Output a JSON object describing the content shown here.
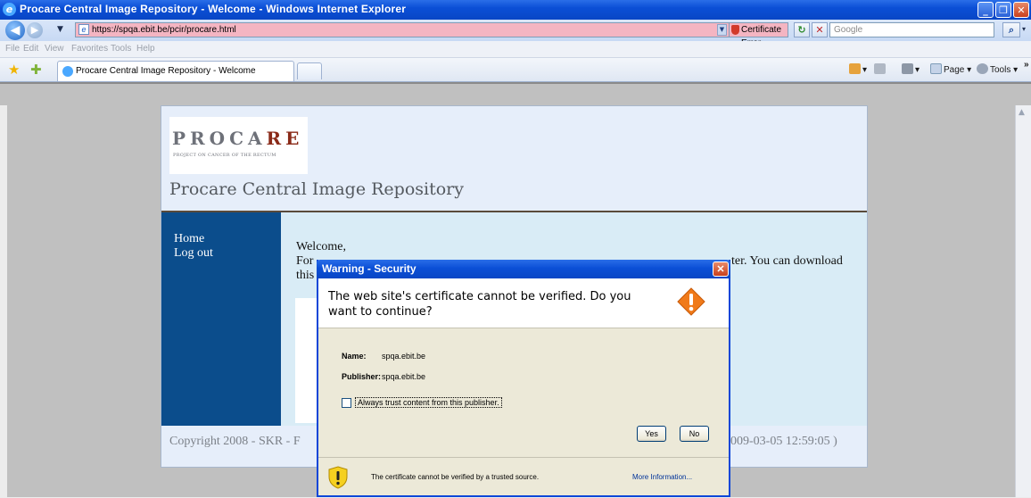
{
  "window": {
    "title": "Procare Central Image Repository - Welcome - Windows Internet Explorer"
  },
  "address": {
    "url": "https://spqa.ebit.be/pcir/procare.html",
    "cert_error": "Certificate Error",
    "search_placeholder": "Google"
  },
  "menu": [
    "File",
    "Edit",
    "View",
    "Favorites",
    "Tools",
    "Help"
  ],
  "tabs": {
    "active_label": "Procare Central Image Repository - Welcome"
  },
  "commands": {
    "page": "Page",
    "tools": "Tools",
    "overflow": "»"
  },
  "site": {
    "logo_main": "PROCA",
    "logo_accent": "RE",
    "logo_sub": "PROJECT ON CANCER OF THE RECTUM",
    "title": "Procare Central Image Repository",
    "nav": [
      "Home",
      "Log out"
    ],
    "welcome": "Welcome,",
    "line2_start": "For",
    "line2_end": "ter. You can download",
    "line3": "this",
    "footer_left": "Copyright 2008 - SKR - F",
    "footer_right": "009-03-05 12:59:05 )"
  },
  "dialog": {
    "title": "Warning - Security",
    "question": "The web site's certificate cannot be verified.  Do you want to continue?",
    "name_label": "Name:",
    "name_value": "spqa.ebit.be",
    "publisher_label": "Publisher:",
    "publisher_value": "spqa.ebit.be",
    "checkbox_label": "Always trust content from this publisher.",
    "yes": "Yes",
    "no": "No",
    "footer_text": "The certificate cannot be verified by a trusted source.",
    "more_info": "More Information..."
  },
  "colors": {
    "accent": "#0b4fd6",
    "sidebar": "#0b4d8c",
    "url_error_bg": "#f4b5c2",
    "logo_red": "#8a2a18"
  }
}
